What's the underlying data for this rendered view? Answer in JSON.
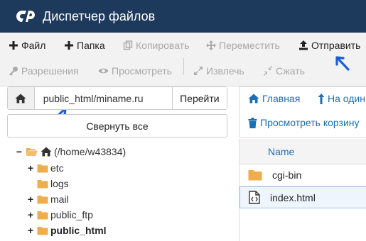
{
  "header": {
    "title": "Диспетчер файлов"
  },
  "toolbar": {
    "file": "Файл",
    "folder": "Папка",
    "copy": "Копировать",
    "move": "Переместить",
    "upload": "Отправить",
    "permissions": "Разрешения",
    "view": "Просмотреть",
    "extract": "Извлечь",
    "compress": "Сжать"
  },
  "path": {
    "value": "public_html/miname.ru",
    "go_label": "Перейти",
    "collapse_label": "Свернуть все"
  },
  "tree": {
    "root": "(/home/w43834)",
    "items": [
      "etc",
      "logs",
      "mail",
      "public_ftp",
      "public_html"
    ]
  },
  "nav": {
    "home": "Главная",
    "up": "На один",
    "trash": "Просмотреть корзину"
  },
  "table": {
    "header_name": "Name",
    "rows": [
      "cgi-bin",
      "index.html"
    ]
  },
  "colors": {
    "header_bg": "#1d3a5c",
    "link": "#1a6fb5",
    "folder": "#f0ad4e",
    "annotation": "#1e5fd8"
  }
}
